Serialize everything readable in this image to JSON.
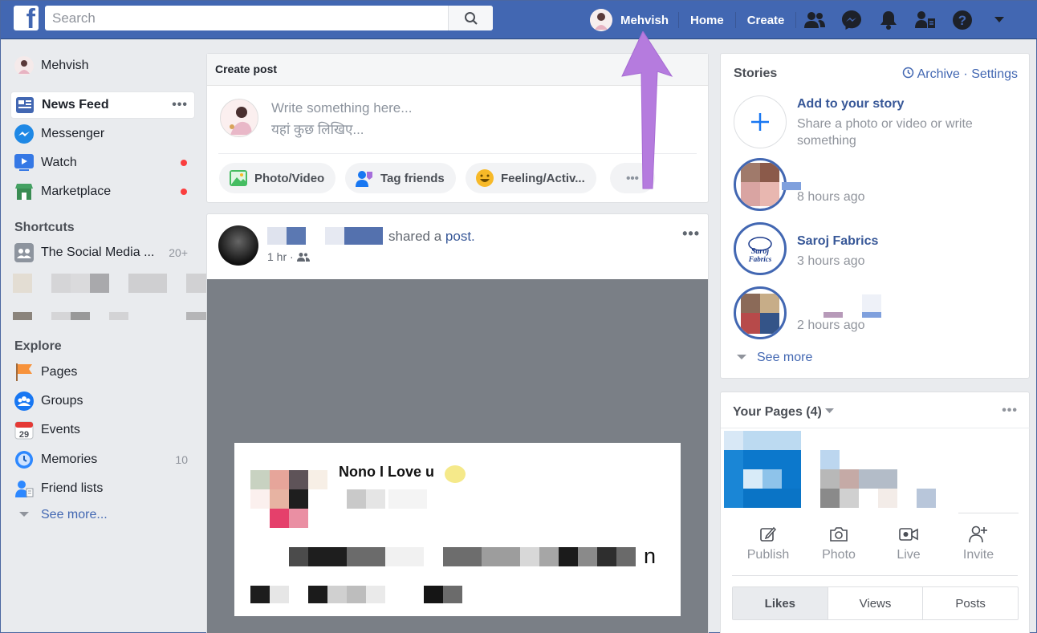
{
  "topbar": {
    "logo": "f",
    "search_placeholder": "Search",
    "profile_name": "Mehvish",
    "links": [
      "Home",
      "Create"
    ],
    "icons": [
      "friends-icon",
      "messenger-icon",
      "notifications-icon",
      "friend-requests-icon",
      "help-icon",
      "dropdown-icon"
    ]
  },
  "sidebar": {
    "profile_name": "Mehvish",
    "items": [
      {
        "label": "News Feed",
        "icon": "news-feed-icon",
        "more": "•••"
      },
      {
        "label": "Messenger",
        "icon": "messenger-icon"
      },
      {
        "label": "Watch",
        "icon": "watch-icon"
      },
      {
        "label": "Marketplace",
        "icon": "marketplace-icon"
      }
    ],
    "shortcuts_title": "Shortcuts",
    "shortcuts": [
      {
        "label": "The Social Media ...",
        "count": "20+"
      }
    ],
    "explore_title": "Explore",
    "explore": [
      {
        "label": "Pages",
        "icon": "flag-icon"
      },
      {
        "label": "Groups",
        "icon": "groups-icon"
      },
      {
        "label": "Events",
        "icon": "calendar-icon",
        "day": "29"
      },
      {
        "label": "Memories",
        "icon": "clock-icon",
        "count": "10"
      },
      {
        "label": "Friend lists",
        "icon": "friend-list-icon"
      }
    ],
    "see_more": "See more..."
  },
  "create_post": {
    "title": "Create post",
    "placeholder_line1": "Write something here...",
    "placeholder_line2": "यहां कुछ लिखिए...",
    "actions": [
      "Photo/Video",
      "Tag friends",
      "Feeling/Activ...",
      "•••"
    ]
  },
  "post": {
    "shared_text": "shared a",
    "link_text": "post.",
    "time": "1 hr ·",
    "more": "•••",
    "inner_title_fragment": "Nono I Love u",
    "inner_text_fragment": "n"
  },
  "stories": {
    "title": "Stories",
    "archive": "Archive",
    "separator": "·",
    "settings": "Settings",
    "add_title": "Add to your story",
    "add_sub": "Share a photo or video or write something",
    "items": [
      {
        "name": "",
        "time": "8 hours ago"
      },
      {
        "name": "Saroj Fabrics",
        "time": "3 hours ago"
      },
      {
        "name": "",
        "time": "2 hours ago"
      }
    ],
    "see_more": "See more"
  },
  "your_pages": {
    "title": "Your Pages (4)",
    "more": "•••",
    "actions": [
      "Publish",
      "Photo",
      "Live",
      "Invite"
    ],
    "tabs": [
      "Likes",
      "Views",
      "Posts"
    ]
  },
  "colors": {
    "brand": "#4267b2",
    "link": "#385898",
    "annotation_arrow": "#b57bde",
    "notification_dot": "#fa3e3e"
  }
}
